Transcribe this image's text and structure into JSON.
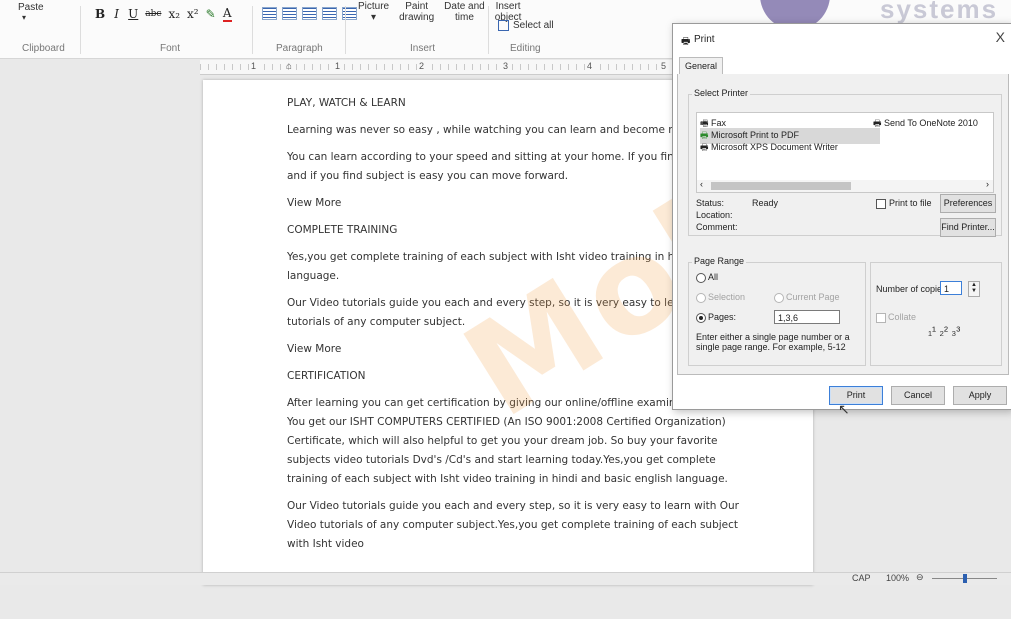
{
  "ribbon": {
    "paste": "Paste",
    "groups": {
      "clipboard": "Clipboard",
      "font": "Font",
      "paragraph": "Paragraph",
      "insert": "Insert",
      "editing": "Editing"
    },
    "font_buttons": [
      "B",
      "I",
      "U",
      "abc",
      "x₂",
      "x²",
      "✎",
      "A"
    ],
    "insert_items": [
      {
        "line1": "Picture",
        "line2": "▾"
      },
      {
        "line1": "Paint",
        "line2": "drawing"
      },
      {
        "line1": "Date and",
        "line2": "time"
      },
      {
        "line1": "Insert",
        "line2": "object"
      }
    ],
    "select_all": "Select all",
    "logo_text": "systems"
  },
  "ruler": {
    "numbers": [
      "1",
      "2",
      "3",
      "4",
      "5"
    ]
  },
  "document": {
    "paragraphs": [
      "PLAY, WATCH & LEARN",
      "Learning was never so easy , while watching you can learn and become master in ar",
      "You can learn according to your speed and sitting at your home. If you find hard you",
      "and if you find subject is easy you can move forward.",
      "View More",
      "COMPLETE TRAINING",
      "Yes,you get complete training of each subject with Isht video training in hindi and ba",
      "language.",
      "Our Video tutorials guide you each and every step, so it is very easy to learn with O",
      "tutorials of any computer subject.",
      "View More",
      "CERTIFICATION",
      "After learning you can get certification by giving our online/offline examination system. You get our ISHT COMPUTERS CERTIFIED (An ISO 9001:2008  Certified Organization) Certificate, which will also helpful to get you your dream job. So buy your favorite subjects video tutorials Dvd's /Cd's and start learning today.Yes,you get complete training of each subject with Isht video training in hindi and basic english language.",
      "Our Video tutorials guide you each and every step, so it is very easy to learn with Our Video tutorials of any computer subject.Yes,you get complete training of each subject with Isht video"
    ],
    "watermark": "Mobiq"
  },
  "status_bar": {
    "caps": "CAP",
    "zoom": "100%",
    "zoom_minus": "⊖"
  },
  "print_dialog": {
    "title": "Print",
    "close": "X",
    "tab": "General",
    "select_printer_label": "Select Printer",
    "printers": [
      {
        "name": "Fax",
        "icon": "fax-icon"
      },
      {
        "name": "Microsoft Print to PDF",
        "icon": "printer-default-icon",
        "selected": true
      },
      {
        "name": "Microsoft XPS Document Writer",
        "icon": "printer-icon"
      },
      {
        "name": "Send To OneNote 2010",
        "icon": "printer-icon"
      }
    ],
    "status_label": "Status:",
    "status_value": "Ready",
    "location_label": "Location:",
    "comment_label": "Comment:",
    "print_to_file": "Print to file",
    "preferences": "Preferences",
    "find_printer": "Find Printer...",
    "page_range_label": "Page Range",
    "all": "All",
    "selection": "Selection",
    "current_page": "Current Page",
    "pages": "Pages:",
    "pages_value": "1,3,6",
    "pages_hint": "Enter either a single page number or a single page range.  For example, 5-12",
    "copies_label": "Number of copies:",
    "copies_value": "1",
    "collate": "Collate",
    "print_button": "Print",
    "cancel_button": "Cancel",
    "apply_button": "Apply"
  }
}
